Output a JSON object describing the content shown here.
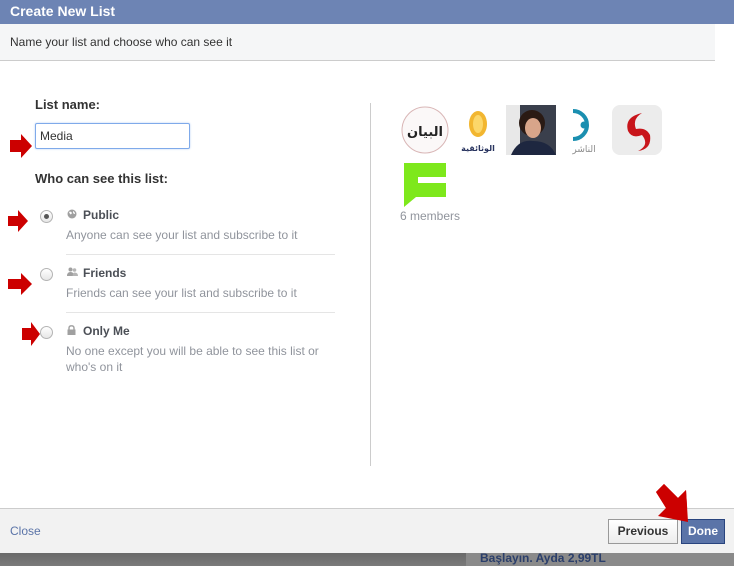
{
  "dialog": {
    "title": "Create New List",
    "subtitle": "Name your list and choose who can see it"
  },
  "form": {
    "list_name_label": "List name:",
    "list_name_value": "Media",
    "visibility_label": "Who can see this list:",
    "options": [
      {
        "title": "Public",
        "description": "Anyone can see your list and subscribe to it",
        "icon": "globe-icon",
        "checked": true
      },
      {
        "title": "Friends",
        "description": "Friends can see your list and subscribe to it",
        "icon": "friends-icon",
        "checked": false
      },
      {
        "title": "Only Me",
        "description": "No one except you will be able to see this list or who's on it",
        "icon": "lock-icon",
        "checked": false
      }
    ]
  },
  "members": {
    "avatars": [
      {
        "name": "albayan-logo",
        "text": "البيان"
      },
      {
        "name": "aljazeera-documentary-logo",
        "text": "الوثائقية"
      },
      {
        "name": "person-photo",
        "text": ""
      },
      {
        "name": "alnasher-logo",
        "text": "الناشر"
      },
      {
        "name": "red-s-logo",
        "text": ""
      },
      {
        "name": "green-logo",
        "text": ""
      }
    ],
    "count_label": "6 members"
  },
  "footer": {
    "close_label": "Close",
    "previous_label": "Previous",
    "done_label": "Done"
  },
  "background": {
    "text": "Başlayın. Ayda 2,99TL"
  },
  "colors": {
    "header": "#6d84b4",
    "accent": "#5b74a8",
    "annotation_arrow": "#cc0000"
  }
}
